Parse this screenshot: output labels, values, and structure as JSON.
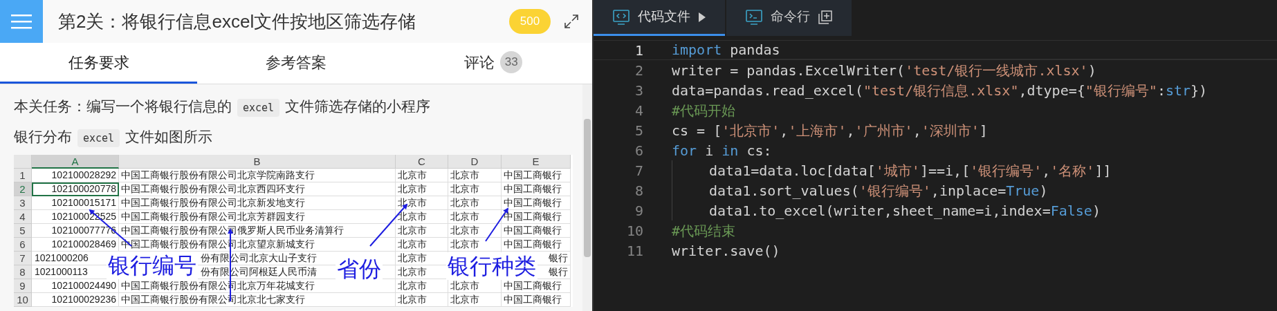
{
  "header": {
    "title": "第2关：将银行信息excel文件按地区筛选存储",
    "score": "500"
  },
  "tabs": [
    {
      "label": "任务要求",
      "selected": true
    },
    {
      "label": "参考答案",
      "selected": false
    },
    {
      "label": "评论",
      "count": "33",
      "selected": false
    }
  ],
  "task": {
    "lines": [
      [
        {
          "t": "本关任务：编写一个将银行信息的",
          "kind": "text"
        },
        {
          "t": "excel",
          "kind": "code"
        },
        {
          "t": "文件筛选存储的小程序",
          "kind": "text"
        }
      ],
      [
        {
          "t": "银行分布",
          "kind": "text"
        },
        {
          "t": "excel",
          "kind": "code"
        },
        {
          "t": "文件如图所示",
          "kind": "text"
        }
      ]
    ]
  },
  "sheet": {
    "columns": [
      {
        "label": "A",
        "selected": true
      },
      {
        "label": "B",
        "selected": false
      },
      {
        "label": "C",
        "selected": false
      },
      {
        "label": "D",
        "selected": false
      },
      {
        "label": "E",
        "selected": false
      }
    ],
    "rows": [
      {
        "n": "1",
        "selected": false,
        "cells": [
          "102100028292",
          "中国工商银行股份有限公司北京学院南路支行",
          "北京市",
          "北京市",
          "中国工商银行"
        ]
      },
      {
        "n": "2",
        "selected": true,
        "cells": [
          "102100020778",
          "中国工商银行股份有限公司北京西四环支行",
          "北京市",
          "北京市",
          "中国工商银行"
        ]
      },
      {
        "n": "3",
        "selected": false,
        "cells": [
          "102100015171",
          "中国工商银行股份有限公司北京新发地支行",
          "北京市",
          "北京市",
          "中国工商银行"
        ]
      },
      {
        "n": "4",
        "selected": false,
        "cells": [
          "102100022525",
          "中国工商银行股份有限公司北京芳群园支行",
          "北京市",
          "北京市",
          "中国工商银行"
        ]
      },
      {
        "n": "5",
        "selected": false,
        "cells": [
          "102100077776",
          "中国工商银行股份有限公司俄罗斯人民币业务清算行",
          "北京市",
          "北京市",
          "中国工商银行"
        ]
      },
      {
        "n": "6",
        "selected": false,
        "cells": [
          "102100028469",
          "中国工商银行股份有限公司北京望京新城支行",
          "北京市",
          "北京市",
          "中国工商银行"
        ]
      },
      {
        "n": "7",
        "selected": false,
        "cells": [
          "1021000206",
          {
            "text": "份有限公司北京大山子支行",
            "kind": "tail"
          },
          "北京市",
          "",
          {
            "text": "银行",
            "kind": "tail"
          }
        ]
      },
      {
        "n": "8",
        "selected": false,
        "cells": [
          "1021000113",
          {
            "text": "份有限公司阿根廷人民币清",
            "kind": "tail"
          },
          "北京市",
          "",
          {
            "text": "银行",
            "kind": "tail"
          }
        ]
      },
      {
        "n": "9",
        "selected": false,
        "cells": [
          "102100024490",
          "中国工商银行股份有限公司北京万年花城支行",
          "北京市",
          "北京市",
          "中国工商银行"
        ]
      },
      {
        "n": "10",
        "selected": false,
        "cells": [
          "102100029236",
          "中国工商银行股份有限公司北京北七家支行",
          "北京市",
          "北京市",
          "中国工商银行"
        ]
      }
    ],
    "annotations": [
      {
        "label": "银行编号"
      },
      {
        "label": "省份"
      },
      {
        "label": "银行种类"
      }
    ]
  },
  "editor": {
    "tabs": [
      {
        "label": "代码文件",
        "selected": true
      },
      {
        "label": "命令行",
        "selected": false
      }
    ],
    "lines": [
      {
        "n": "1",
        "current": true,
        "tokens": [
          {
            "t": "import",
            "kind": "kw"
          },
          {
            "t": " pandas",
            "kind": "tx"
          }
        ]
      },
      {
        "n": "2",
        "current": false,
        "tokens": [
          {
            "t": "writer = pandas.ExcelWriter(",
            "kind": "tx"
          },
          {
            "t": "'test/银行一线城市.xlsx'",
            "kind": "str"
          },
          {
            "t": ")",
            "kind": "tx"
          }
        ]
      },
      {
        "n": "3",
        "current": false,
        "tokens": [
          {
            "t": "data=pandas.read_excel(",
            "kind": "tx"
          },
          {
            "t": "\"test/银行信息.xlsx\"",
            "kind": "str"
          },
          {
            "t": ",dtype={",
            "kind": "tx"
          },
          {
            "t": "\"银行编号\"",
            "kind": "str"
          },
          {
            "t": ":",
            "kind": "tx"
          },
          {
            "t": "str",
            "kind": "kw"
          },
          {
            "t": "})",
            "kind": "tx"
          }
        ]
      },
      {
        "n": "4",
        "current": false,
        "tokens": [
          {
            "t": "#代码开始",
            "kind": "cm"
          }
        ]
      },
      {
        "n": "5",
        "current": false,
        "tokens": [
          {
            "t": "cs = [",
            "kind": "tx"
          },
          {
            "t": "'北京市'",
            "kind": "str"
          },
          {
            "t": ",",
            "kind": "tx"
          },
          {
            "t": "'上海市'",
            "kind": "str"
          },
          {
            "t": ",",
            "kind": "tx"
          },
          {
            "t": "'广州市'",
            "kind": "str"
          },
          {
            "t": ",",
            "kind": "tx"
          },
          {
            "t": "'深圳市'",
            "kind": "str"
          },
          {
            "t": "]",
            "kind": "tx"
          }
        ]
      },
      {
        "n": "6",
        "current": false,
        "tokens": [
          {
            "t": "for",
            "kind": "kw"
          },
          {
            "t": " i ",
            "kind": "tx"
          },
          {
            "t": "in",
            "kind": "kw"
          },
          {
            "t": " cs:",
            "kind": "tx"
          }
        ],
        "children": [
          {
            "n": "7",
            "current": false,
            "tokens": [
              {
                "t": "data1=data.loc[data[",
                "kind": "tx"
              },
              {
                "t": "'城市'",
                "kind": "str"
              },
              {
                "t": "]==i,[",
                "kind": "tx"
              },
              {
                "t": "'银行编号'",
                "kind": "str"
              },
              {
                "t": ",",
                "kind": "tx"
              },
              {
                "t": "'名称'",
                "kind": "str"
              },
              {
                "t": "]]",
                "kind": "tx"
              }
            ]
          },
          {
            "n": "8",
            "current": false,
            "tokens": [
              {
                "t": "data1.sort_values(",
                "kind": "tx"
              },
              {
                "t": "'银行编号'",
                "kind": "str"
              },
              {
                "t": ",inplace=",
                "kind": "tx"
              },
              {
                "t": "True",
                "kind": "kw"
              },
              {
                "t": ")",
                "kind": "tx"
              }
            ]
          },
          {
            "n": "9",
            "current": false,
            "tokens": [
              {
                "t": "data1.to_excel(writer,sheet_name=i,index=",
                "kind": "tx"
              },
              {
                "t": "False",
                "kind": "kw"
              },
              {
                "t": ")",
                "kind": "tx"
              }
            ]
          }
        ]
      },
      {
        "n": "10",
        "current": false,
        "tokens": [
          {
            "t": "#代码结束",
            "kind": "cm"
          }
        ]
      },
      {
        "n": "11",
        "current": false,
        "tokens": [
          {
            "t": "writer.save()",
            "kind": "tx"
          }
        ]
      }
    ]
  }
}
